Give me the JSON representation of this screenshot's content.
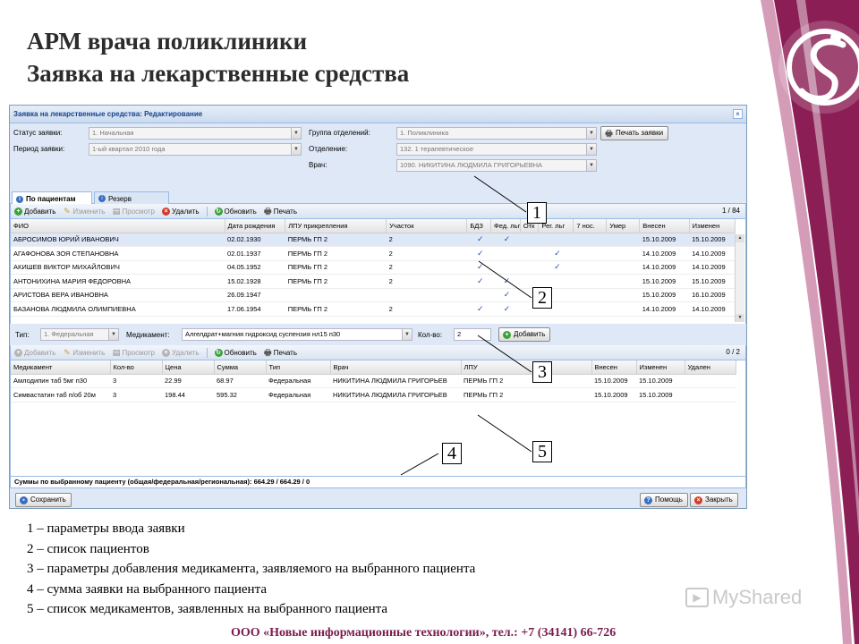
{
  "slide": {
    "title_line1": "АРМ врача поликлиники",
    "title_line2": "Заявка на лекарственные средства",
    "accent": "#8a1e55"
  },
  "window": {
    "title": "Заявка на лекарственные средства: Редактирование",
    "close": "×",
    "params": {
      "status_label": "Статус заявки:",
      "status_value": "1. Начальная",
      "period_label": "Период заявки:",
      "period_value": "1-ый квартал 2010 года",
      "group_label": "Группа отделений:",
      "group_value": "1. Поликлиника",
      "dept_label": "Отделение:",
      "dept_value": "132. 1 терапевтическое",
      "doctor_label": "Врач:",
      "doctor_value": "1090. НИКИТИНА ЛЮДМИЛА ГРИГОРЬЕВНА",
      "print_button": "Печать заявки"
    },
    "tabs": [
      {
        "label": "По пациентам",
        "icon": "info-icon"
      },
      {
        "label": "Резерв",
        "icon": "info-icon"
      }
    ],
    "patients_toolbar": {
      "add": "Добавить",
      "edit": "Изменить",
      "view": "Просмотр",
      "delete": "Удалить",
      "refresh": "Обновить",
      "print": "Печать",
      "counter": "1 / 84"
    },
    "patients": {
      "columns": [
        "ФИО",
        "Дата рождения",
        "ЛПУ прикрепления",
        "Участок",
        "БДЗ",
        "Фед. льг",
        "Отк",
        "Рег. льг",
        "7 нос.",
        "Умер",
        "Внесен",
        "Изменен"
      ],
      "rows": [
        {
          "fio": "АБРОСИМОВ ЮРИЙ ИВАНОВИЧ",
          "dob": "02.02.1930",
          "lpu": "ПЕРМЬ ГП 2",
          "uch": "2",
          "bdz": "✓",
          "fed": "✓",
          "otk": "",
          "reg": "",
          "nos": "",
          "umer": "",
          "vnesen": "15.10.2009",
          "izm": "15.10.2009"
        },
        {
          "fio": "АГАФОНОВА ЗОЯ СТЕПАНОВНА",
          "dob": "02.01.1937",
          "lpu": "ПЕРМЬ ГП 2",
          "uch": "2",
          "bdz": "✓",
          "fed": "",
          "otk": "",
          "reg": "✓",
          "nos": "",
          "umer": "",
          "vnesen": "14.10.2009",
          "izm": "14.10.2009"
        },
        {
          "fio": "АКИШЕВ ВИКТОР МИХАЙЛОВИЧ",
          "dob": "04.05.1952",
          "lpu": "ПЕРМЬ ГП 2",
          "uch": "2",
          "bdz": "✓",
          "fed": "",
          "otk": "",
          "reg": "✓",
          "nos": "",
          "umer": "",
          "vnesen": "14.10.2009",
          "izm": "14.10.2009"
        },
        {
          "fio": "АНТОНИХИНА МАРИЯ ФЕДОРОВНА",
          "dob": "15.02.1928",
          "lpu": "ПЕРМЬ ГП 2",
          "uch": "2",
          "bdz": "✓",
          "fed": "✓",
          "otk": "",
          "reg": "",
          "nos": "",
          "umer": "",
          "vnesen": "15.10.2009",
          "izm": "15.10.2009"
        },
        {
          "fio": "АРИСТОВА ВЕРА ИВАНОВНА",
          "dob": "26.09.1947",
          "lpu": "",
          "uch": "",
          "bdz": "",
          "fed": "✓",
          "otk": "",
          "reg": "",
          "nos": "",
          "umer": "",
          "vnesen": "15.10.2009",
          "izm": "16.10.2009"
        },
        {
          "fio": "БАЗАНОВА ЛЮДМИЛА ОЛИМПИЕВНА",
          "dob": "17.06.1954",
          "lpu": "ПЕРМЬ ГП 2",
          "uch": "2",
          "bdz": "✓",
          "fed": "✓",
          "otk": "",
          "reg": "",
          "nos": "",
          "umer": "",
          "vnesen": "14.10.2009",
          "izm": "14.10.2009"
        }
      ]
    },
    "add_row": {
      "type_label": "Тип:",
      "type_value": "1. Федеральная",
      "med_label": "Медикамент:",
      "med_value": "Алгелдрат+магния гидроксид суспензия нл15 п30",
      "qty_label": "Кол-во:",
      "qty_value": "2",
      "add_button": "Добавить"
    },
    "meds_toolbar": {
      "add": "Добавить",
      "edit": "Изменить",
      "view": "Просмотр",
      "delete": "Удалить",
      "refresh": "Обновить",
      "print": "Печать",
      "counter": "0 / 2"
    },
    "meds": {
      "columns": [
        "Медикамент",
        "Кол-во",
        "Цена",
        "Сумма",
        "Тип",
        "Врач",
        "ЛПУ",
        "Внесен",
        "Изменен",
        "Удален"
      ],
      "rows": [
        {
          "name": "Амлодипин таб 5мг п30",
          "qty": "3",
          "price": "22.99",
          "sum": "68.97",
          "type": "Федеральная",
          "doctor": "НИКИТИНА ЛЮДМИЛА ГРИГОРЬЕВ",
          "lpu": "ПЕРМЬ ГП 2",
          "vnesen": "15.10.2009",
          "izm": "15.10.2009",
          "del": ""
        },
        {
          "name": "Симвастатин таб п/об 20м",
          "qty": "3",
          "price": "198.44",
          "sum": "595.32",
          "type": "Федеральная",
          "doctor": "НИКИТИНА ЛЮДМИЛА ГРИГОРЬЕВ",
          "lpu": "ПЕРМЬ ГП 2",
          "vnesen": "15.10.2009",
          "izm": "15.10.2009",
          "del": ""
        }
      ]
    },
    "sum_text": "Суммы по выбранному пациенту (общая/федеральная/региональная): 664.29 / 664.29 / 0",
    "bottom": {
      "save": "Сохранить",
      "help": "Помощь",
      "close": "Закрыть"
    }
  },
  "callouts": [
    "1",
    "2",
    "3",
    "4",
    "5"
  ],
  "legend": [
    "1 – параметры ввода заявки",
    "2 – список пациентов",
    "3 – параметры добавления медикамента, заявляемого на выбранного пациента",
    "4 – сумма заявки на выбранного пациента",
    "5 – список медикаментов, заявленных на выбранного пациента"
  ],
  "company": "ООО «Новые информационные технологии», тел.: +7 (34141) 66-726",
  "watermark": "MyShared"
}
